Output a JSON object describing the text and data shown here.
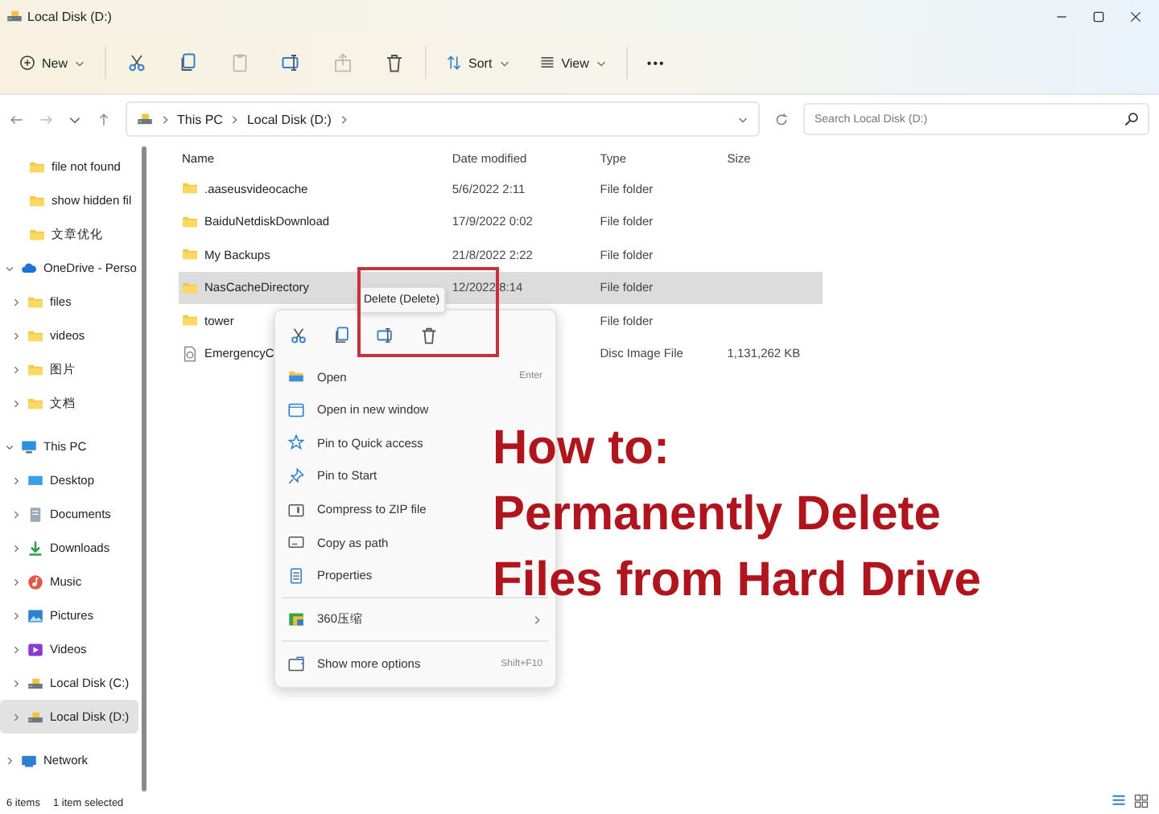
{
  "window": {
    "title": "Local Disk (D:)"
  },
  "toolbar": {
    "new": "New",
    "sort": "Sort",
    "view": "View",
    "more": "•••",
    "actions": [
      {
        "kind": "cut",
        "disabled": false
      },
      {
        "kind": "copy",
        "disabled": false
      },
      {
        "kind": "paste",
        "disabled": true
      },
      {
        "kind": "rename",
        "disabled": false
      },
      {
        "kind": "share",
        "disabled": true
      },
      {
        "kind": "delete",
        "disabled": false
      }
    ]
  },
  "address": {
    "path": [
      "This PC",
      "Local Disk (D:)"
    ],
    "search": {
      "placeholder": "Search Local Disk (D:)"
    }
  },
  "sidebar": {
    "pinned": [
      {
        "label": "file not found"
      },
      {
        "label": "show hidden fil"
      },
      {
        "label": "文章优化"
      }
    ],
    "items": [
      {
        "label": "OneDrive - Perso",
        "kind": "cloud",
        "expanded": true,
        "selected": false,
        "children": [
          {
            "label": "files",
            "kind": "folder",
            "expanded": false,
            "selected": false
          },
          {
            "label": "videos",
            "kind": "folder",
            "expanded": false,
            "selected": false
          },
          {
            "label": "图片",
            "kind": "folder",
            "expanded": false,
            "selected": false
          },
          {
            "label": "文档",
            "kind": "folder",
            "expanded": false,
            "selected": false
          }
        ]
      },
      {
        "label": "This PC",
        "kind": "pc",
        "expanded": true,
        "selected": false,
        "children": [
          {
            "label": "Desktop",
            "kind": "desktop",
            "expanded": false,
            "selected": false
          },
          {
            "label": "Documents",
            "kind": "documents",
            "expanded": false,
            "selected": false
          },
          {
            "label": "Downloads",
            "kind": "downloads",
            "expanded": false,
            "selected": false
          },
          {
            "label": "Music",
            "kind": "music",
            "expanded": false,
            "selected": false
          },
          {
            "label": "Pictures",
            "kind": "pictures",
            "expanded": false,
            "selected": false
          },
          {
            "label": "Videos",
            "kind": "videos",
            "expanded": false,
            "selected": false
          },
          {
            "label": "Local Disk (C:)",
            "kind": "drive",
            "expanded": false,
            "selected": false
          },
          {
            "label": "Local Disk (D:)",
            "kind": "drive",
            "expanded": false,
            "selected": true
          }
        ]
      },
      {
        "label": "Network",
        "kind": "network",
        "expanded": false,
        "selected": false
      }
    ]
  },
  "table": {
    "columns": [
      "Name",
      "Date modified",
      "Type",
      "Size"
    ],
    "rows": [
      {
        "kind": "folder",
        "name": ".aaseusvideocache",
        "date": "5/6/2022 2:11",
        "type": "File folder",
        "size": "",
        "selected": false
      },
      {
        "kind": "folder",
        "name": "BaiduNetdiskDownload",
        "date": "17/9/2022 0:02",
        "type": "File folder",
        "size": "",
        "selected": false
      },
      {
        "kind": "folder",
        "name": "My Backups",
        "date": "21/8/2022 2:22",
        "type": "File folder",
        "size": "",
        "selected": false
      },
      {
        "kind": "folder",
        "name": "NasCacheDirectory",
        "date": "12/2022 8:14",
        "type": "File folder",
        "size": "",
        "selected": true
      },
      {
        "kind": "folder",
        "name": "tower",
        "date": "",
        "type": "File folder",
        "size": "",
        "selected": false
      },
      {
        "kind": "file",
        "name": "EmergencyC",
        "date": "",
        "type": "Disc Image File",
        "size": "1,131,262 KB",
        "selected": false
      }
    ]
  },
  "status_bar": {
    "count": "6 items",
    "selection": "1 item selected"
  },
  "context_menu": {
    "tooltip": "Delete (Delete)",
    "quick_actions": [
      {
        "kind": "cut"
      },
      {
        "kind": "copy"
      },
      {
        "kind": "rename"
      },
      {
        "kind": "delete"
      }
    ],
    "items": [
      {
        "kind": "open",
        "label": "Open",
        "shortcut": "Enter"
      },
      {
        "kind": "window",
        "label": "Open in new window"
      },
      {
        "kind": "star",
        "label": "Pin to Quick access"
      },
      {
        "kind": "pin",
        "label": "Pin to Start"
      },
      {
        "kind": "zip",
        "label": "Compress to ZIP file"
      },
      {
        "kind": "path",
        "label": "Copy as path"
      },
      {
        "kind": "properties",
        "label": "Properties"
      },
      {
        "kind": "separator"
      },
      {
        "kind": "archive",
        "label": "360压缩",
        "submenu": true
      },
      {
        "kind": "separator"
      },
      {
        "kind": "more",
        "label": "Show more options",
        "shortcut": "Shift+F10"
      }
    ]
  },
  "headline": [
    "How to:",
    "Permanently Delete",
    "Files from Hard Drive"
  ]
}
